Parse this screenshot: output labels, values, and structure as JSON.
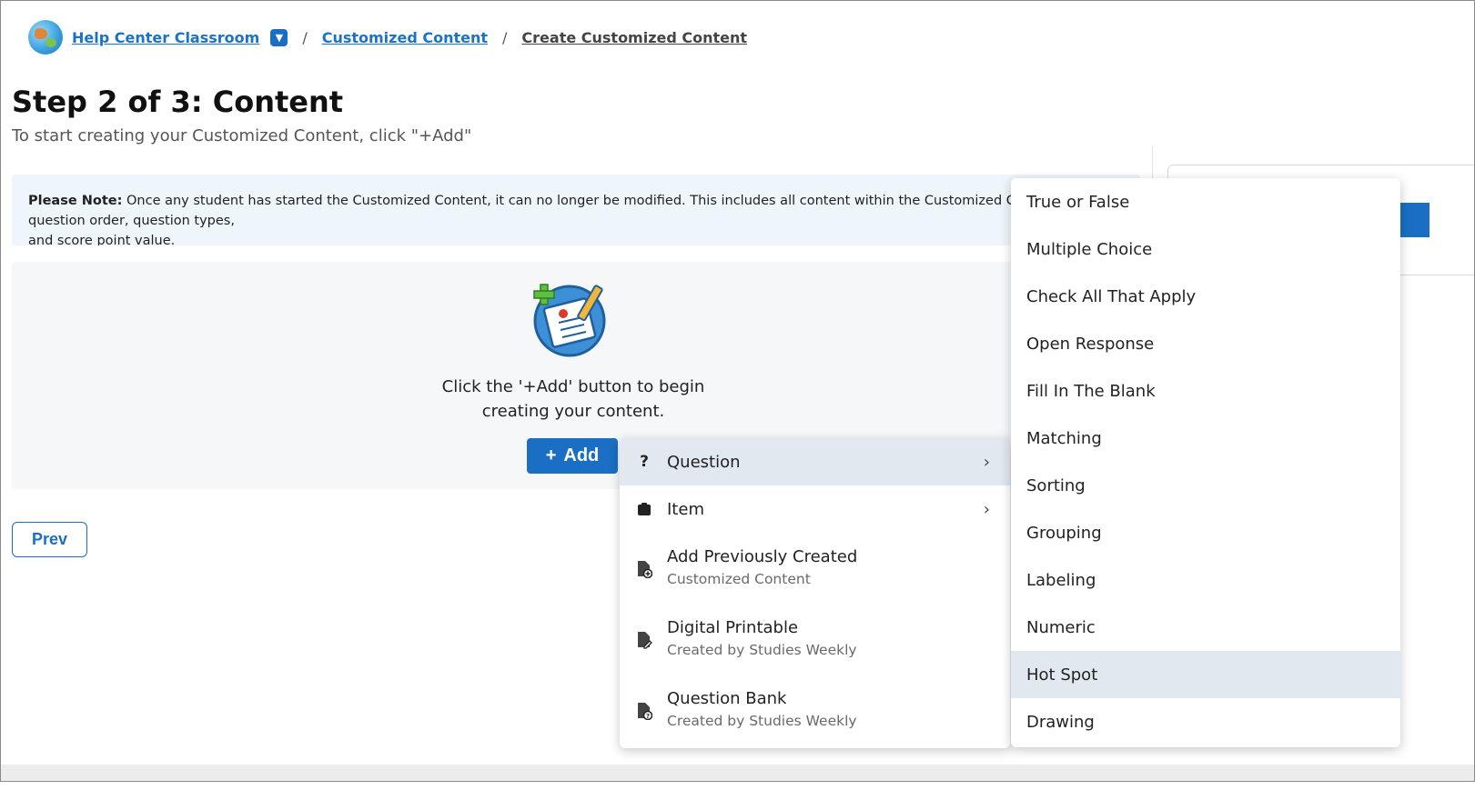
{
  "breadcrumb": {
    "classroom": "Help Center Classroom",
    "separator": "/",
    "customized": "Customized Content",
    "current": "Create Customized Content"
  },
  "page": {
    "title": "Step 2 of 3: Content",
    "subtitle": "To start creating your Customized Content, click \"+Add\""
  },
  "note": {
    "label": "Please Note:",
    "text": " Once any student has started the Customized Content, it can no longer be modified. This includes all content within the Customized Content, question order, question types,",
    "text2": "and score point value."
  },
  "empty_state": {
    "line1": "Click the '+Add' button to begin",
    "line2": "creating your content."
  },
  "buttons": {
    "add_icon": "+",
    "add": "Add",
    "prev": "Prev"
  },
  "add_menu": {
    "question": "Question",
    "item": "Item",
    "add_previous": "Add Previously Created",
    "add_previous_sub": "Customized Content",
    "digital_printable": "Digital Printable",
    "digital_printable_sub": "Created by Studies Weekly",
    "question_bank": "Question Bank",
    "question_bank_sub": "Created by Studies Weekly"
  },
  "question_types": [
    "True or False",
    "Multiple Choice",
    "Check All That Apply",
    "Open Response",
    "Fill In The Blank",
    "Matching",
    "Sorting",
    "Grouping",
    "Labeling",
    "Numeric",
    "Hot Spot",
    "Drawing"
  ],
  "selected_question_type": "Hot Spot",
  "colors": {
    "primary": "#1a6fc4",
    "note_bg": "#eef6fc",
    "selected_bg": "#e1e8ef"
  }
}
